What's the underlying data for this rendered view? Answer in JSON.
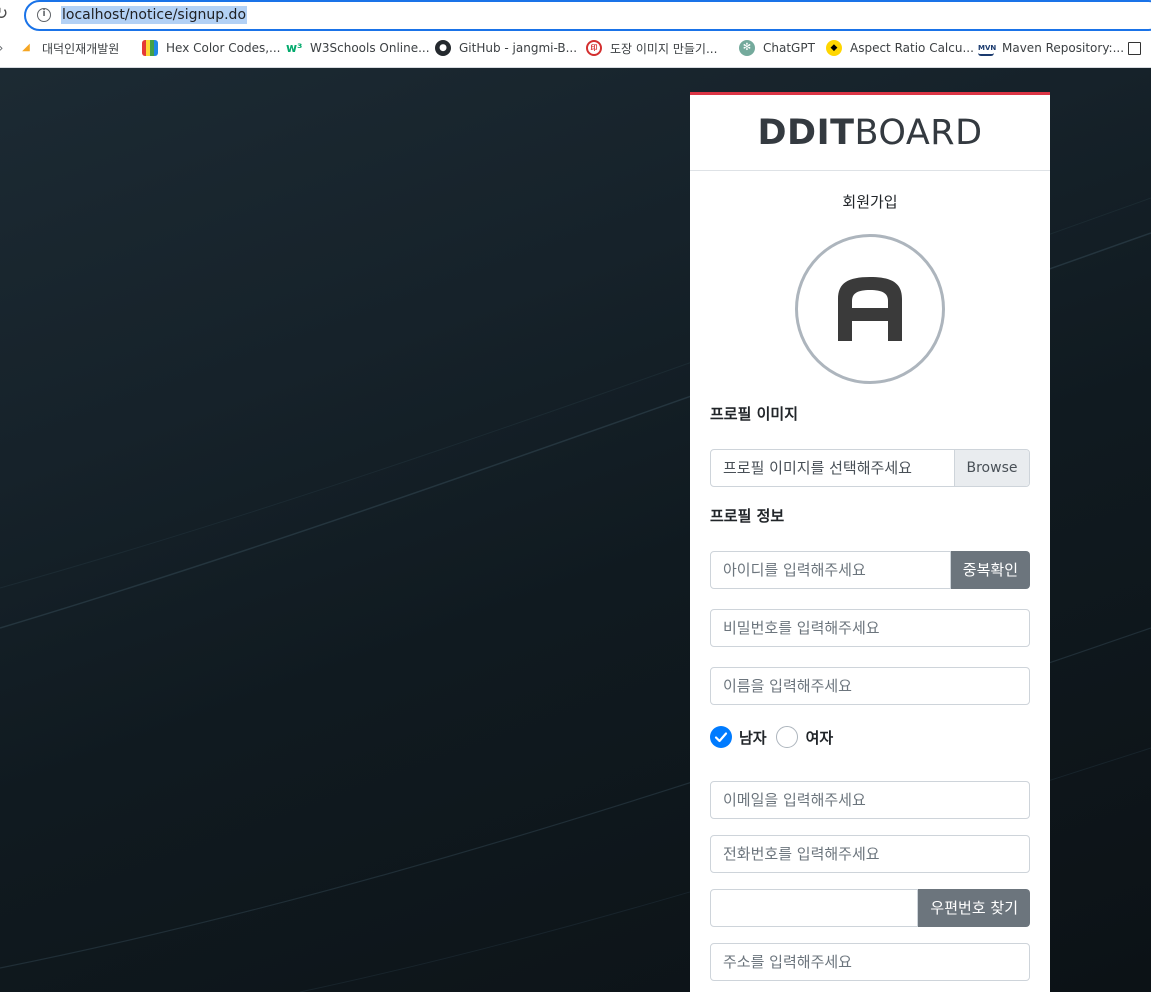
{
  "browser": {
    "url": "localhost/notice/signup.do",
    "bookmarks": [
      {
        "label": "대덕인재개발원",
        "icon": "ddit-icon"
      },
      {
        "label": "Hex Color Codes,...",
        "icon": "hex-color-icon"
      },
      {
        "label": "W3Schools Online...",
        "icon": "w3schools-icon"
      },
      {
        "label": "GitHub - jangmi-B...",
        "icon": "github-icon"
      },
      {
        "label": "도장 이미지 만들기...",
        "icon": "stamp-icon"
      },
      {
        "label": "ChatGPT",
        "icon": "chatgpt-icon"
      },
      {
        "label": "Aspect Ratio Calcu...",
        "icon": "aspect-ratio-icon"
      },
      {
        "label": "Maven Repository:...",
        "icon": "maven-icon"
      }
    ]
  },
  "card": {
    "brand_bold": "DDIT",
    "brand_light": "BOARD",
    "subtitle": "회원가입",
    "accent_color": "#dc3545",
    "profile_image_label": "프로필 이미지",
    "file_placeholder": "프로필 이미지를 선택해주세요",
    "browse_label": "Browse",
    "profile_info_label": "프로필 정보",
    "id_placeholder": "아이디를 입력해주세요",
    "dup_check_label": "중복확인",
    "password_placeholder": "비밀번호를 입력해주세요",
    "name_placeholder": "이름을 입력해주세요",
    "gender_male": "남자",
    "gender_female": "여자",
    "gender_selected": "남자",
    "email_placeholder": "이메일을 입력해주세요",
    "phone_placeholder": "전화번호를 입력해주세요",
    "postcode_value": "",
    "postcode_button": "우편번호 찾기",
    "address_placeholder": "주소를 입력해주세요"
  }
}
